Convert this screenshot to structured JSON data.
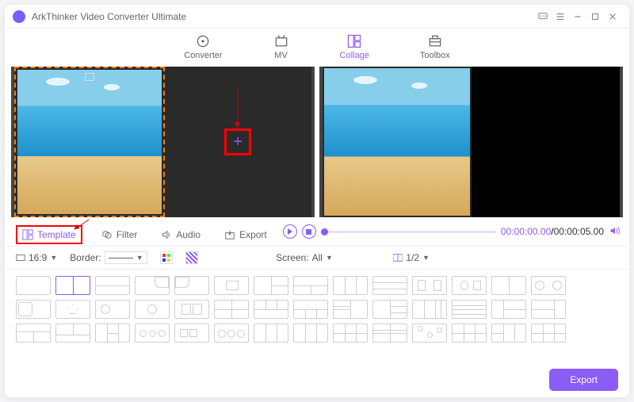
{
  "app": {
    "title": "ArkThinker Video Converter Ultimate"
  },
  "mainTabs": {
    "converter": "Converter",
    "mv": "MV",
    "collage": "Collage",
    "toolbox": "Toolbox"
  },
  "subTabs": {
    "template": "Template",
    "filter": "Filter",
    "audio": "Audio",
    "export": "Export"
  },
  "playback": {
    "current": "00:00:00.00",
    "total": "00:00:05.00",
    "sep": "/"
  },
  "options": {
    "aspect": "16:9",
    "borderLabel": "Border:",
    "screenLabel": "Screen:",
    "screenVal": "All",
    "splitVal": "1/2"
  },
  "footer": {
    "export": "Export"
  }
}
